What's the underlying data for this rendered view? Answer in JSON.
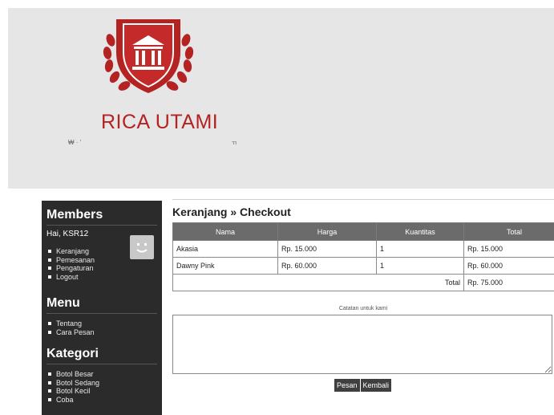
{
  "brand": {
    "name": "RICA UTAMI",
    "accent": "#b42222"
  },
  "header": {
    "garbled_left": "₩ · '",
    "garbled_right": "ㄲ"
  },
  "sidebar": {
    "members_title": "Members",
    "greeting": "Hai, KSR12",
    "member_items": [
      "Keranjang",
      "Pemesanan",
      "Pengaturan",
      "Logout"
    ],
    "menu_title": "Menu",
    "menu_items": [
      "Tentang",
      "Cara Pesan"
    ],
    "kategori_title": "Kategori",
    "kategori_items": [
      "Botol Besar",
      "Botol Sedang",
      "Botol Kecil",
      "Coba"
    ]
  },
  "checkout": {
    "title": "Keranjang » Checkout",
    "columns": [
      "Nama",
      "Harga",
      "Kuantitas",
      "Total"
    ],
    "rows": [
      {
        "nama": "Akasia",
        "harga": "Rp. 15.000",
        "kuantitas": "1",
        "total": "Rp. 15.000"
      },
      {
        "nama": "Dawny Pink",
        "harga": "Rp. 60.000",
        "kuantitas": "1",
        "total": "Rp. 60.000"
      }
    ],
    "total_label": "Total",
    "total_value": "Rp. 75.000",
    "note_label": "Catatan untuk kami",
    "pesan_label": "Pesan",
    "kembali_label": "Kembali"
  }
}
